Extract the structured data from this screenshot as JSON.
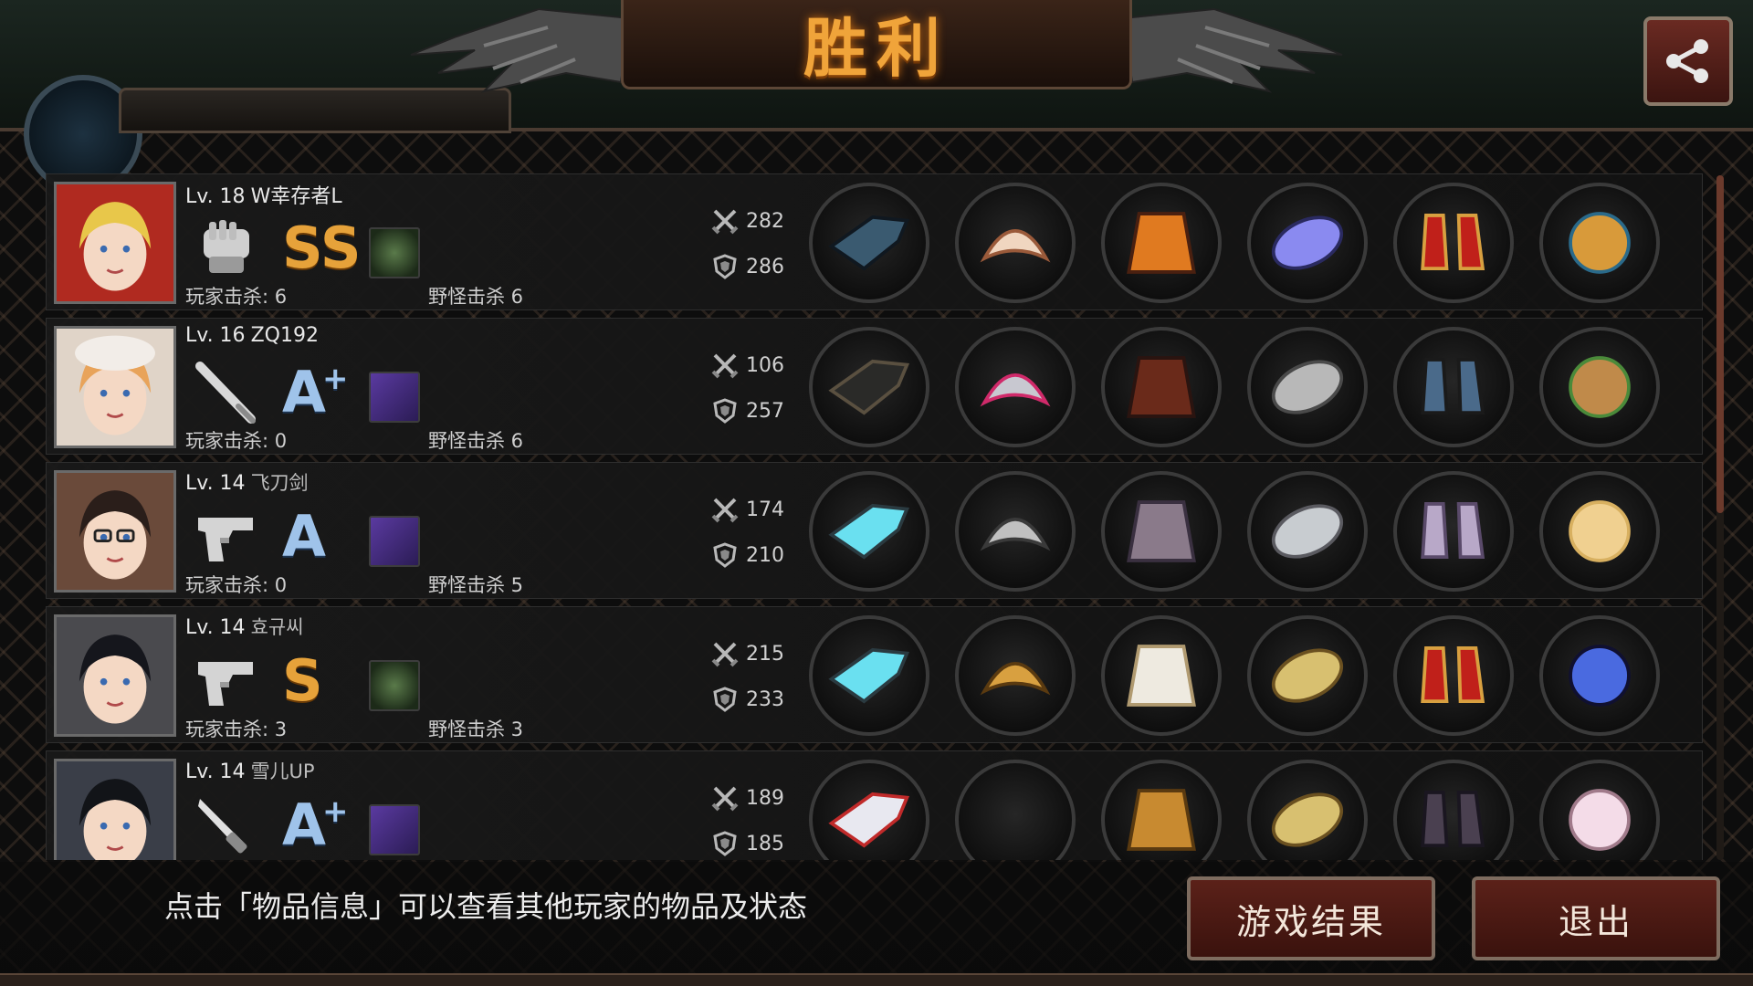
{
  "header": {
    "title": "胜利",
    "partial_name": "W幸存者L",
    "share_icon": "share-icon"
  },
  "colors": {
    "title": "#f0a43a",
    "grade_gold": "#e6a23a",
    "grade_blue": "#9fc3ea",
    "button_bg": "#5b2119"
  },
  "players": [
    {
      "level": "Lv. 18",
      "name": "W幸存者L",
      "weapon": "gauntlet-icon",
      "grade": "SS",
      "grade_plus": "",
      "grade_color": "gold",
      "skill": "green",
      "player_kills": "玩家击杀: 6",
      "monster_kills": "野怪击杀 6",
      "attack": "282",
      "defense": "286",
      "items": [
        "gauntlet-item",
        "feather-tiara-item",
        "flame-armor-item",
        "lightning-bracer-item",
        "red-heels-item",
        "earrings-item"
      ]
    },
    {
      "level": "Lv. 16",
      "name": "ZQ192",
      "weapon": "bat-icon",
      "grade": "A",
      "grade_plus": "+",
      "grade_color": "blue",
      "skill": "purple",
      "player_kills": "玩家击杀: 0",
      "monster_kills": "野怪击杀 6",
      "attack": "106",
      "defense": "257",
      "items": [
        "umbrella-item",
        "tech-helmet-item",
        "leather-coat-item",
        "shield-disc-item",
        "boots-item",
        "cat-box-item"
      ]
    },
    {
      "level": "Lv. 14",
      "name": "飞刀剑",
      "weapon": "pistol-icon",
      "grade": "A",
      "grade_plus": "",
      "grade_color": "blue",
      "skill": "purple",
      "player_kills": "玩家击杀: 0",
      "monster_kills": "野怪击杀 5",
      "attack": "174",
      "defense": "210",
      "items": [
        "laser-gun-item",
        "knight-helm-item",
        "plate-armor-item",
        "blade-arm-item",
        "tall-boots-item",
        "fan-item"
      ]
    },
    {
      "level": "Lv. 14",
      "name": "효규씨",
      "weapon": "pistol-icon",
      "grade": "S",
      "grade_plus": "",
      "grade_color": "gold",
      "skill": "green",
      "player_kills": "玩家击杀: 3",
      "monster_kills": "野怪击杀 3",
      "attack": "215",
      "defense": "233",
      "items": [
        "laser-gun-item",
        "gold-helm-item",
        "white-robe-item",
        "gold-shield-item",
        "red-heels-item",
        "galaxy-item"
      ]
    },
    {
      "level": "Lv. 14",
      "name": "雪儿UP",
      "weapon": "knife-icon",
      "grade": "A",
      "grade_plus": "+",
      "grade_color": "blue",
      "skill": "purple",
      "player_kills": "",
      "monster_kills": "",
      "attack": "189",
      "defense": "185",
      "items": [
        "katana-item",
        "empty-slot",
        "gold-armor-item",
        "gold-shield-item",
        "dark-boots-item",
        "pearl-item"
      ]
    }
  ],
  "footer": {
    "hint": "点击「物品信息」可以查看其他玩家的物品及状态",
    "result_button": "游戏结果",
    "exit_button": "退出"
  }
}
